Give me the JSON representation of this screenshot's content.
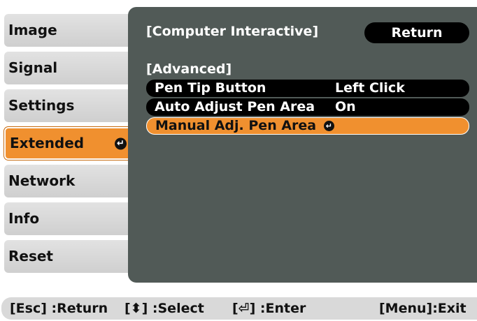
{
  "sidebar": {
    "items": [
      {
        "label": "Image"
      },
      {
        "label": "Signal"
      },
      {
        "label": "Settings"
      },
      {
        "label": "Extended",
        "active": true
      },
      {
        "label": "Network"
      },
      {
        "label": "Info"
      },
      {
        "label": "Reset"
      }
    ]
  },
  "panel": {
    "title": "[Computer Interactive]",
    "return_label": "Return",
    "section": "[Advanced]",
    "rows": [
      {
        "label": "Pen Tip Button",
        "value": "Left Click"
      },
      {
        "label": "Auto Adjust Pen Area",
        "value": "On"
      },
      {
        "label": "Manual Adj. Pen Area",
        "value": ""
      }
    ]
  },
  "footer": {
    "esc": "[Esc] :Return",
    "select": "[⬍] :Select",
    "enter": "[⏎] :Enter",
    "menu": "[Menu]:Exit"
  },
  "colors": {
    "accent": "#f0902f",
    "panel": "#515a57",
    "menu_bg": "#dcdcdc"
  },
  "icons": {
    "enter": "enter-icon",
    "updown": "up-down-arrow-icon"
  }
}
